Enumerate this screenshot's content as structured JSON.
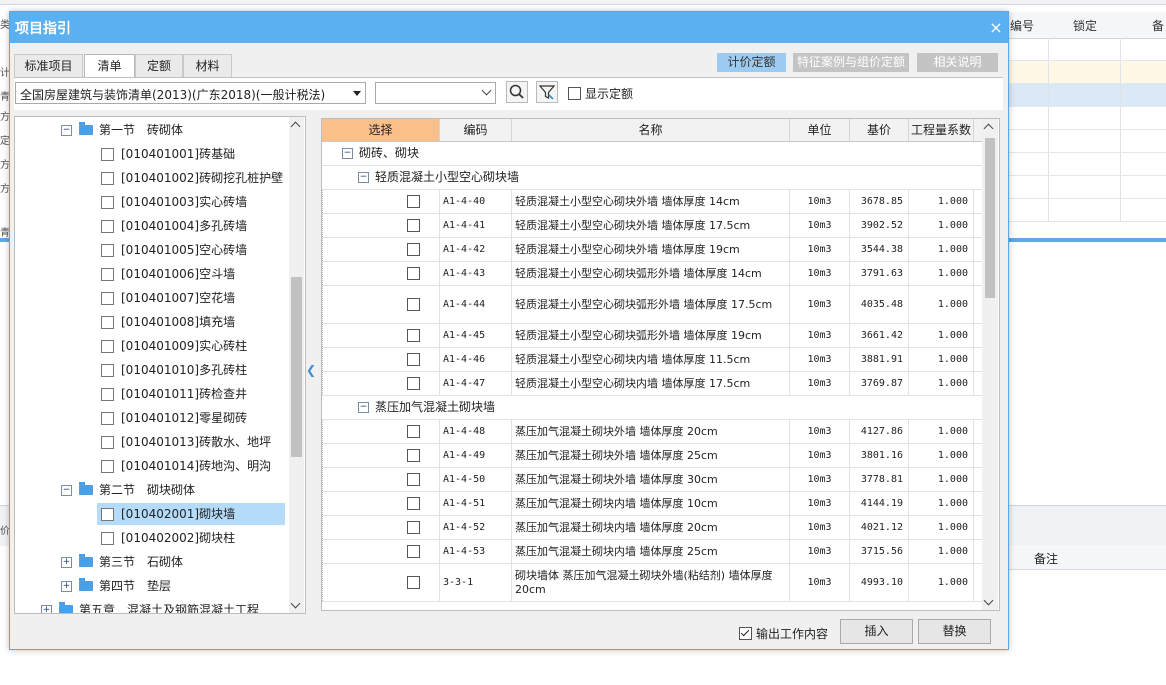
{
  "background": {
    "header_cols": [
      "编号",
      "锁定",
      "备"
    ],
    "lower_header": "备注",
    "left_chars": [
      "类",
      "计",
      "青",
      "方",
      "定",
      "方",
      "方",
      "青",
      "价"
    ]
  },
  "dialog": {
    "title": "项目指引",
    "close": "×",
    "tabs": [
      "标准项目",
      "清单",
      "定额",
      "材料"
    ],
    "active_tab": 1,
    "buttons": {
      "pricing": "计价定额",
      "feature": "特征案例与组价定额",
      "related": "相关说明"
    },
    "library_select": "全国房屋建筑与装饰清单(2013)(广东2018)(一般计税法)",
    "filter_value": "",
    "show_quota_label": "显示定额",
    "show_quota_checked": false,
    "output_label": "输出工作内容",
    "output_checked": true,
    "insert_label": "插入",
    "replace_label": "替换"
  },
  "tree": [
    {
      "type": "section",
      "label": "第一节　砖砌体",
      "expanded": true,
      "level": 1
    },
    {
      "type": "item",
      "label": "[010401001]砖基础",
      "level": 2
    },
    {
      "type": "item",
      "label": "[010401002]砖砌挖孔桩护壁",
      "level": 2
    },
    {
      "type": "item",
      "label": "[010401003]实心砖墙",
      "level": 2
    },
    {
      "type": "item",
      "label": "[010401004]多孔砖墙",
      "level": 2
    },
    {
      "type": "item",
      "label": "[010401005]空心砖墙",
      "level": 2
    },
    {
      "type": "item",
      "label": "[010401006]空斗墙",
      "level": 2
    },
    {
      "type": "item",
      "label": "[010401007]空花墙",
      "level": 2
    },
    {
      "type": "item",
      "label": "[010401008]填充墙",
      "level": 2
    },
    {
      "type": "item",
      "label": "[010401009]实心砖柱",
      "level": 2
    },
    {
      "type": "item",
      "label": "[010401010]多孔砖柱",
      "level": 2
    },
    {
      "type": "item",
      "label": "[010401011]砖检查井",
      "level": 2
    },
    {
      "type": "item",
      "label": "[010401012]零星砌砖",
      "level": 2
    },
    {
      "type": "item",
      "label": "[010401013]砖散水、地坪",
      "level": 2
    },
    {
      "type": "item",
      "label": "[010401014]砖地沟、明沟",
      "level": 2
    },
    {
      "type": "section",
      "label": "第二节　砌块砌体",
      "expanded": true,
      "level": 1
    },
    {
      "type": "item",
      "label": "[010402001]砌块墙",
      "level": 2,
      "selected": true
    },
    {
      "type": "item",
      "label": "[010402002]砌块柱",
      "level": 2
    },
    {
      "type": "section",
      "label": "第三节　石砌体",
      "expanded": false,
      "level": 1
    },
    {
      "type": "section",
      "label": "第四节　垫层",
      "expanded": false,
      "level": 1
    },
    {
      "type": "chapter",
      "label": "第五章　混凝土及钢筋混凝土工程",
      "expanded": false,
      "level": 0
    }
  ],
  "grid": {
    "columns": [
      "选择",
      "编码",
      "名称",
      "单位",
      "基价",
      "工程量系数"
    ],
    "group_root": "砌砖、砌块",
    "groups": [
      {
        "label": "轻质混凝土小型空心砌块墙",
        "rows": [
          {
            "code": "A1-4-40",
            "name": "轻质混凝土小型空心砌块外墙 墙体厚度 14cm",
            "unit": "10m3",
            "price": "3678.85",
            "factor": "1.000"
          },
          {
            "code": "A1-4-41",
            "name": "轻质混凝土小型空心砌块外墙 墙体厚度 17.5cm",
            "unit": "10m3",
            "price": "3902.52",
            "factor": "1.000"
          },
          {
            "code": "A1-4-42",
            "name": "轻质混凝土小型空心砌块外墙 墙体厚度 19cm",
            "unit": "10m3",
            "price": "3544.38",
            "factor": "1.000"
          },
          {
            "code": "A1-4-43",
            "name": "轻质混凝土小型空心砌块弧形外墙 墙体厚度 14cm",
            "unit": "10m3",
            "price": "3791.63",
            "factor": "1.000"
          },
          {
            "code": "A1-4-44",
            "name": "轻质混凝土小型空心砌块弧形外墙 墙体厚度 17.5cm",
            "unit": "10m3",
            "price": "4035.48",
            "factor": "1.000"
          },
          {
            "code": "A1-4-45",
            "name": "轻质混凝土小型空心砌块弧形外墙 墙体厚度 19cm",
            "unit": "10m3",
            "price": "3661.42",
            "factor": "1.000"
          },
          {
            "code": "A1-4-46",
            "name": "轻质混凝土小型空心砌块内墙 墙体厚度 11.5cm",
            "unit": "10m3",
            "price": "3881.91",
            "factor": "1.000"
          },
          {
            "code": "A1-4-47",
            "name": "轻质混凝土小型空心砌块内墙 墙体厚度 17.5cm",
            "unit": "10m3",
            "price": "3769.87",
            "factor": "1.000"
          }
        ]
      },
      {
        "label": "蒸压加气混凝土砌块墙",
        "rows": [
          {
            "code": "A1-4-48",
            "name": "蒸压加气混凝土砌块外墙 墙体厚度 20cm",
            "unit": "10m3",
            "price": "4127.86",
            "factor": "1.000"
          },
          {
            "code": "A1-4-49",
            "name": "蒸压加气混凝土砌块外墙 墙体厚度 25cm",
            "unit": "10m3",
            "price": "3801.16",
            "factor": "1.000"
          },
          {
            "code": "A1-4-50",
            "name": "蒸压加气混凝土砌块外墙 墙体厚度 30cm",
            "unit": "10m3",
            "price": "3778.81",
            "factor": "1.000"
          },
          {
            "code": "A1-4-51",
            "name": "蒸压加气混凝土砌块内墙 墙体厚度 10cm",
            "unit": "10m3",
            "price": "4144.19",
            "factor": "1.000"
          },
          {
            "code": "A1-4-52",
            "name": "蒸压加气混凝土砌块内墙 墙体厚度 20cm",
            "unit": "10m3",
            "price": "4021.12",
            "factor": "1.000"
          },
          {
            "code": "A1-4-53",
            "name": "蒸压加气混凝土砌块内墙 墙体厚度 25cm",
            "unit": "10m3",
            "price": "3715.56",
            "factor": "1.000"
          },
          {
            "code": "3-3-1",
            "name": "砌块墙体 蒸压加气混凝土砌块外墙(粘结剂) 墙体厚度 20cm",
            "unit": "10m3",
            "price": "4993.10",
            "factor": "1.000"
          }
        ]
      }
    ]
  },
  "colors": {
    "title_bar": "#5ab0f0",
    "selected_header": "#fbc08a",
    "selected_row": "#b4dcfa",
    "accent": "#3a8fd6"
  }
}
